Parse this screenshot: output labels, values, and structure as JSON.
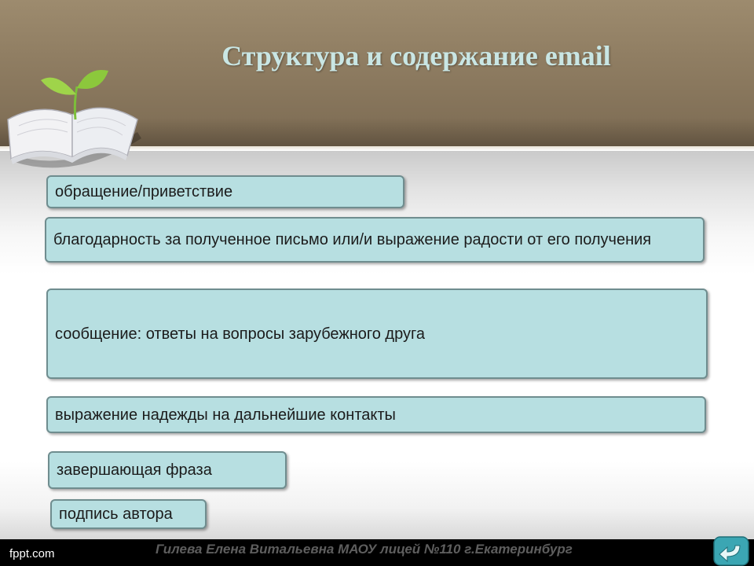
{
  "slide": {
    "title": "Структура и содержание email",
    "items": [
      {
        "label": "обращение/приветствие"
      },
      {
        "label": "благодарность за полученное письмо или/и выражение радости от его получения"
      },
      {
        "label": "сообщение: ответы на вопросы зарубежного друга"
      },
      {
        "label": "выражение надежды на дальнейшие контакты"
      },
      {
        "label": "завершающая фраза"
      },
      {
        "label": "подпись автора"
      }
    ]
  },
  "footer": {
    "site": "fppt.com",
    "author": "Гилева Елена Витальевна МАОУ лицей №110 г.Екатеринбург"
  },
  "icons": {
    "decoration": "open-book-with-sprout-icon",
    "navigation": "return-arrow-icon"
  },
  "colors": {
    "header": "#8f7d62",
    "title": "#c9e6e4",
    "box_fill": "#b7dfe1",
    "box_border": "#6f8d8f",
    "footer": "#000000"
  }
}
